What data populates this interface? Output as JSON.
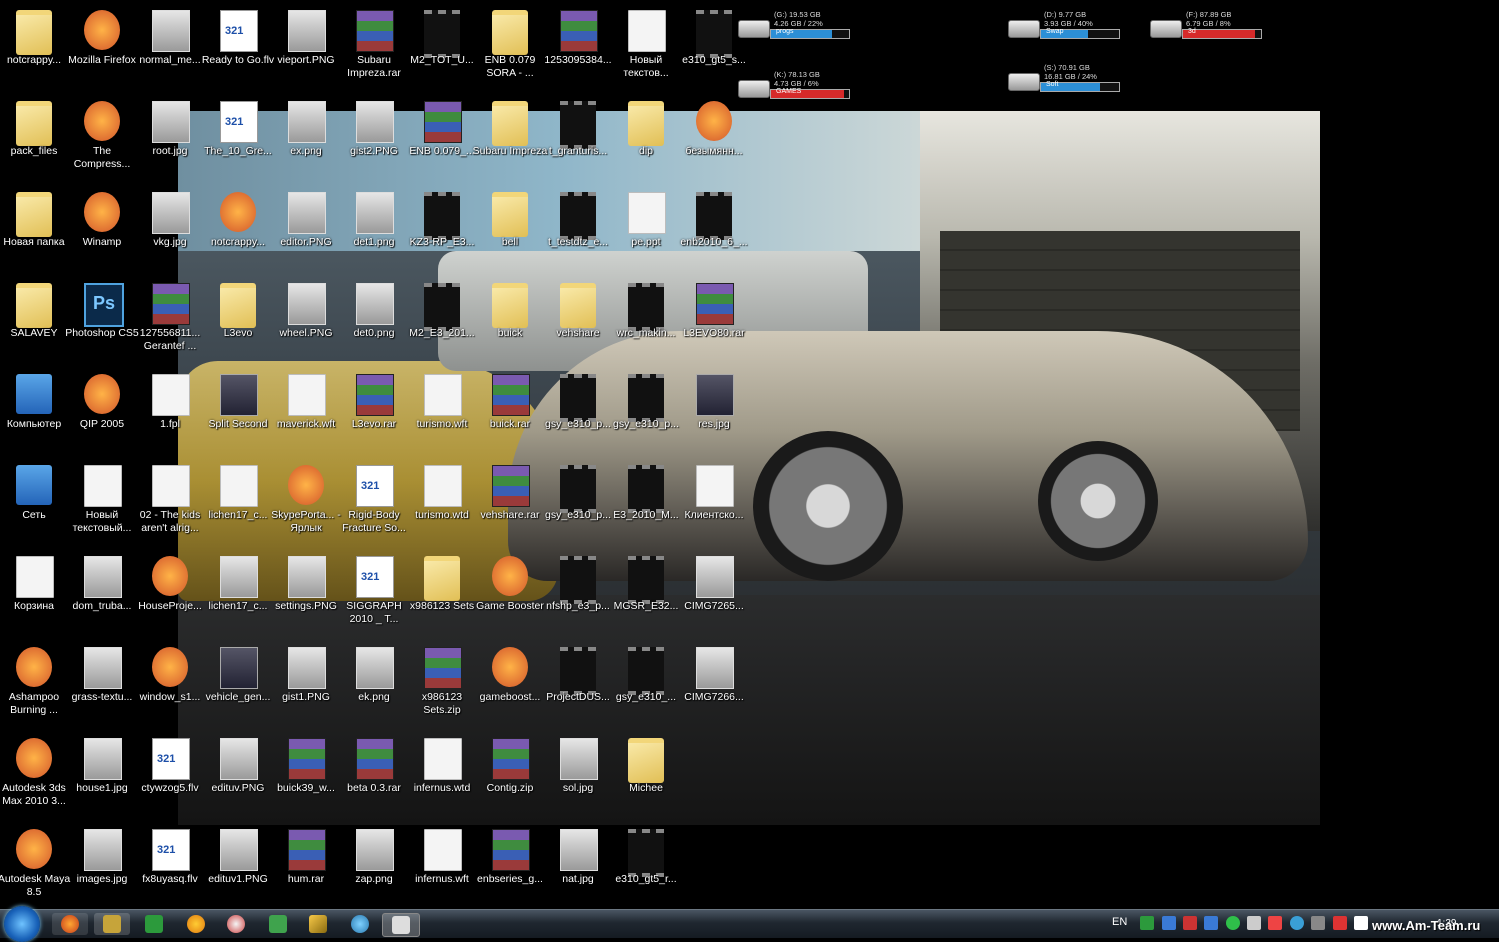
{
  "desktop": {
    "icons": [
      {
        "label": "notcrappy...",
        "type": "folder"
      },
      {
        "label": "pack_files",
        "type": "folder"
      },
      {
        "label": "Новая папка",
        "type": "folder"
      },
      {
        "label": "SALAVEY",
        "type": "folder"
      },
      {
        "label": "Компьютер",
        "type": "pc"
      },
      {
        "label": "Сеть",
        "type": "pc"
      },
      {
        "label": "Корзина",
        "type": "doc"
      },
      {
        "label": "Ashampoo Burning ...",
        "type": "app"
      },
      {
        "label": "Autodesk 3ds Max 2010 3...",
        "type": "app"
      },
      {
        "label": "Autodesk Maya 8.5",
        "type": "app"
      },
      {
        "label": "Mozilla Firefox",
        "type": "app"
      },
      {
        "label": "The Compress...",
        "type": "app"
      },
      {
        "label": "Winamp",
        "type": "app"
      },
      {
        "label": "Photoshop CS5",
        "type": "ps"
      },
      {
        "label": "QIP 2005",
        "type": "app"
      },
      {
        "label": "Новый текстовый...",
        "type": "doc"
      },
      {
        "label": "dom_truba...",
        "type": "img"
      },
      {
        "label": "grass-textu...",
        "type": "img"
      },
      {
        "label": "house1.jpg",
        "type": "img"
      },
      {
        "label": "images.jpg",
        "type": "img"
      },
      {
        "label": "normal_me...",
        "type": "img"
      },
      {
        "label": "root.jpg",
        "type": "img"
      },
      {
        "label": "vkg.jpg",
        "type": "img"
      },
      {
        "label": "127556811... Gerantef ...",
        "type": "rar"
      },
      {
        "label": "1.fpl",
        "type": "doc"
      },
      {
        "label": "02 - The kids aren't alrig...",
        "type": "doc"
      },
      {
        "label": "HouseProje...",
        "type": "app"
      },
      {
        "label": "window_s1...",
        "type": "app"
      },
      {
        "label": "ctywzog5.flv",
        "type": "flv"
      },
      {
        "label": "fx8uyasq.flv",
        "type": "flv"
      },
      {
        "label": "Ready to Go.flv",
        "type": "flv"
      },
      {
        "label": "The_10_Gre...",
        "type": "flv"
      },
      {
        "label": "notcrappy...",
        "type": "app"
      },
      {
        "label": "L3evo",
        "type": "folder"
      },
      {
        "label": "Split Second",
        "type": "imgdark"
      },
      {
        "label": "lichen17_c...",
        "type": "doc"
      },
      {
        "label": "lichen17_c...",
        "type": "img"
      },
      {
        "label": "vehicle_gen...",
        "type": "imgdark"
      },
      {
        "label": "edituv.PNG",
        "type": "img"
      },
      {
        "label": "edituv1.PNG",
        "type": "img"
      },
      {
        "label": "vieport.PNG",
        "type": "img"
      },
      {
        "label": "ex.png",
        "type": "img"
      },
      {
        "label": "editor.PNG",
        "type": "img"
      },
      {
        "label": "wheel.PNG",
        "type": "img"
      },
      {
        "label": "maverick.wft",
        "type": "doc"
      },
      {
        "label": "SkypePorta... - Ярлык",
        "type": "app"
      },
      {
        "label": "settings.PNG",
        "type": "img"
      },
      {
        "label": "gist1.PNG",
        "type": "img"
      },
      {
        "label": "buick39_w...",
        "type": "rar"
      },
      {
        "label": "hum.rar",
        "type": "rar"
      },
      {
        "label": "Subaru Impreza.rar",
        "type": "rar"
      },
      {
        "label": "gist2.PNG",
        "type": "img"
      },
      {
        "label": "det1.png",
        "type": "img"
      },
      {
        "label": "det0.png",
        "type": "img"
      },
      {
        "label": "L3evo.rar",
        "type": "rar"
      },
      {
        "label": "Rigid-Body Fracture So...",
        "type": "flv"
      },
      {
        "label": "SIGGRAPH 2010 _ T...",
        "type": "flv"
      },
      {
        "label": "ek.png",
        "type": "img"
      },
      {
        "label": "beta 0.3.rar",
        "type": "rar"
      },
      {
        "label": "zap.png",
        "type": "img"
      },
      {
        "label": "M2_TOT_U...",
        "type": "vid"
      },
      {
        "label": "ENB 0.079_...",
        "type": "rar"
      },
      {
        "label": "KZ3-RP_E3...",
        "type": "vid"
      },
      {
        "label": "M2_E3_201...",
        "type": "vid"
      },
      {
        "label": "turismo.wft",
        "type": "doc"
      },
      {
        "label": "turismo.wtd",
        "type": "doc"
      },
      {
        "label": "x986123 Sets",
        "type": "folder"
      },
      {
        "label": "x986123 Sets.zip",
        "type": "rar"
      },
      {
        "label": "infernus.wtd",
        "type": "doc"
      },
      {
        "label": "infernus.wft",
        "type": "doc"
      },
      {
        "label": "ENB 0.079 SORA - ...",
        "type": "folder"
      },
      {
        "label": "Subaru Impreza",
        "type": "folder"
      },
      {
        "label": "bell",
        "type": "folder"
      },
      {
        "label": "buick",
        "type": "folder"
      },
      {
        "label": "buick.rar",
        "type": "rar"
      },
      {
        "label": "vehshare.rar",
        "type": "rar"
      },
      {
        "label": "Game Booster",
        "type": "app"
      },
      {
        "label": "gameboost...",
        "type": "app"
      },
      {
        "label": "Contig.zip",
        "type": "rar"
      },
      {
        "label": "enbseries_g...",
        "type": "rar"
      },
      {
        "label": "1253095384...",
        "type": "rar"
      },
      {
        "label": "t_granturis...",
        "type": "vid"
      },
      {
        "label": "t_testdtz_e...",
        "type": "vid"
      },
      {
        "label": "vehshare",
        "type": "folder"
      },
      {
        "label": "gsy_e310_p...",
        "type": "vid"
      },
      {
        "label": "gsy_e310_p...",
        "type": "vid"
      },
      {
        "label": "nfshp_e3_p...",
        "type": "vid"
      },
      {
        "label": "ProjectDUS...",
        "type": "vid"
      },
      {
        "label": "sol.jpg",
        "type": "img"
      },
      {
        "label": "nat.jpg",
        "type": "img"
      },
      {
        "label": "Новый текстов...",
        "type": "doc"
      },
      {
        "label": "dip",
        "type": "folder"
      },
      {
        "label": "pe.ppt",
        "type": "doc"
      },
      {
        "label": "wrc_makin...",
        "type": "vid"
      },
      {
        "label": "gsy_e310_p...",
        "type": "vid"
      },
      {
        "label": "E3_2010_M...",
        "type": "vid"
      },
      {
        "label": "MGSR_E32...",
        "type": "vid"
      },
      {
        "label": "gsy_e310_...",
        "type": "vid"
      },
      {
        "label": "Michee",
        "type": "folder"
      },
      {
        "label": "e310_gt5_r...",
        "type": "vid"
      },
      {
        "label": "e310_gt5_s...",
        "type": "vid"
      },
      {
        "label": "безымянн...",
        "type": "app"
      },
      {
        "label": "enb2010_6_...",
        "type": "vid"
      },
      {
        "label": "L3EVO80.rar",
        "type": "rar"
      },
      {
        "label": "res.jpg",
        "type": "imgdark"
      },
      {
        "label": "Клиентско...",
        "type": "doc"
      },
      {
        "label": "CIMG7265...",
        "type": "img"
      },
      {
        "label": "CIMG7266...",
        "type": "img"
      }
    ]
  },
  "drives": [
    {
      "name": "(G:) 19.53 GB",
      "free": "4.26 GB / 22%",
      "label": "progs",
      "percent": 78,
      "color": "#2c8fd6"
    },
    {
      "name": "(K:) 78.13 GB",
      "free": "4.73 GB / 6%",
      "label": "GAMES",
      "percent": 94,
      "color": "#d62a2a"
    },
    {
      "name": "(D:) 9.77 GB",
      "free": "3.93 GB / 40%",
      "label": "Swap",
      "percent": 60,
      "color": "#2c8fd6"
    },
    {
      "name": "(S:) 70.91 GB",
      "free": "16.81 GB / 24%",
      "label": "Soft",
      "percent": 76,
      "color": "#2c8fd6"
    },
    {
      "name": "(F:) 87.89 GB",
      "free": "6.79 GB / 8%",
      "label": "3d",
      "percent": 92,
      "color": "#d62a2a"
    }
  ],
  "taskbar": {
    "lang": "EN",
    "clock": "1:39",
    "pinned": [
      "firefox-icon",
      "media-icon",
      "green-app-icon",
      "sun-icon",
      "globe-icon",
      "yandex-icon",
      "winamp-icon",
      "people-icon",
      "active-window-icon"
    ]
  },
  "watermark": "www.Am-Team.ru"
}
